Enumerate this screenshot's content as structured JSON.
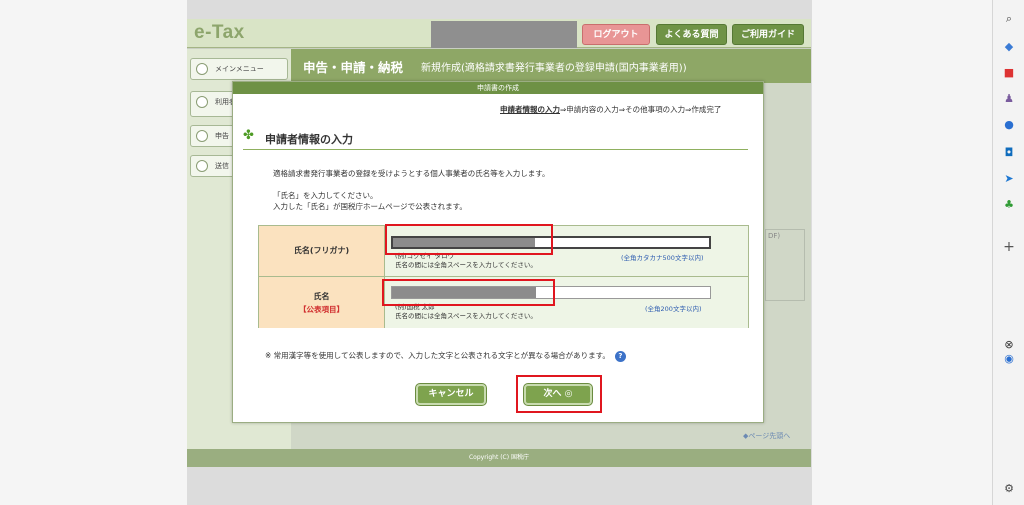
{
  "header": {
    "logo": "e-Tax",
    "logout_label": "ログアウト",
    "faq_label": "よくある質問",
    "guide_label": "ご利用ガイド"
  },
  "nav": {
    "items": [
      {
        "label": "メインメニュー"
      },
      {
        "label": "利用者"
      },
      {
        "label": "申告"
      },
      {
        "label": "送信"
      }
    ]
  },
  "title_bar": {
    "main": "申告・申請・納税",
    "sub": "新規作成(適格請求書発行事業者の登録申請(国内事業者用))"
  },
  "background": {
    "pdf_label": "DF)",
    "page_top_link": "ページ先頭へ",
    "copyright": "Copyright (C) 国税庁"
  },
  "modal": {
    "header": "申請書の作成",
    "steps": {
      "current": "申請者情報の入力",
      "rest": "⇒申請内容の入力⇒その他事項の入力⇒作成完了"
    },
    "section_title": "申請者情報の入力",
    "intro": "適格請求書発行事業者の登録を受けようとする個人事業者の氏名等を入力します。",
    "instructions": [
      "「氏名」を入力してください。",
      "入力した「氏名」が国税庁ホームページで公表されます。"
    ],
    "fields": [
      {
        "label": "氏名(フリガナ)",
        "public_tag": "",
        "example": "(例)コクゼイ タロウ",
        "hint": "氏名の間には全角スペースを入力してください。",
        "limit": "(全角カタカナ500文字以内)"
      },
      {
        "label": "氏名",
        "public_tag": "【公表項目】",
        "example": "(例)国税 太郎",
        "hint": "氏名の間には全角スペースを入力してください。",
        "limit": "(全角200文字以内)"
      }
    ],
    "note": "※ 常用漢字等を使用して公表しますので、入力した文字と公表される文字とが異なる場合があります。",
    "help_icon": "?",
    "cancel_label": "キャンセル",
    "next_label": "次へ ◎"
  }
}
